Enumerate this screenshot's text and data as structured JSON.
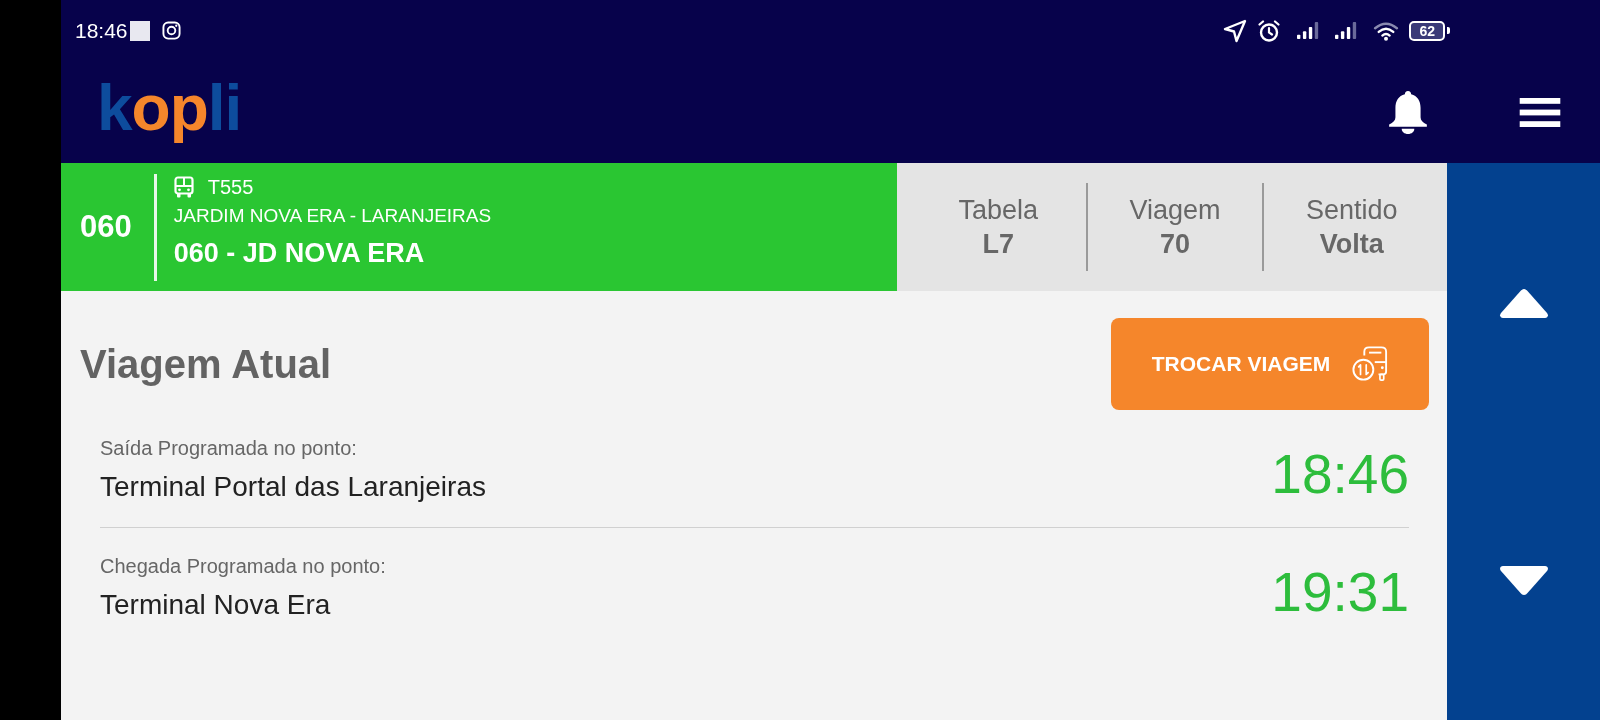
{
  "status_bar": {
    "time": "18:46",
    "battery": "62"
  },
  "header": {
    "logo": "kopli"
  },
  "route": {
    "number": "060",
    "vehicle": "T555",
    "line_name": "JARDIM NOVA ERA - LARANJEIRAS",
    "route_name": "060 - JD NOVA ERA"
  },
  "trip_info": [
    {
      "label": "Tabela",
      "value": "L7"
    },
    {
      "label": "Viagem",
      "value": "70"
    },
    {
      "label": "Sentido",
      "value": "Volta"
    }
  ],
  "current_trip": {
    "title": "Viagem Atual",
    "button": "TROCAR VIAGEM",
    "stops": [
      {
        "label": "Saída Programada no ponto:",
        "name": "Terminal Portal das Laranjeiras",
        "time": "18:46"
      },
      {
        "label": "Chegada Programada no ponto:",
        "name": "Terminal Nova Era",
        "time": "19:31"
      }
    ]
  }
}
